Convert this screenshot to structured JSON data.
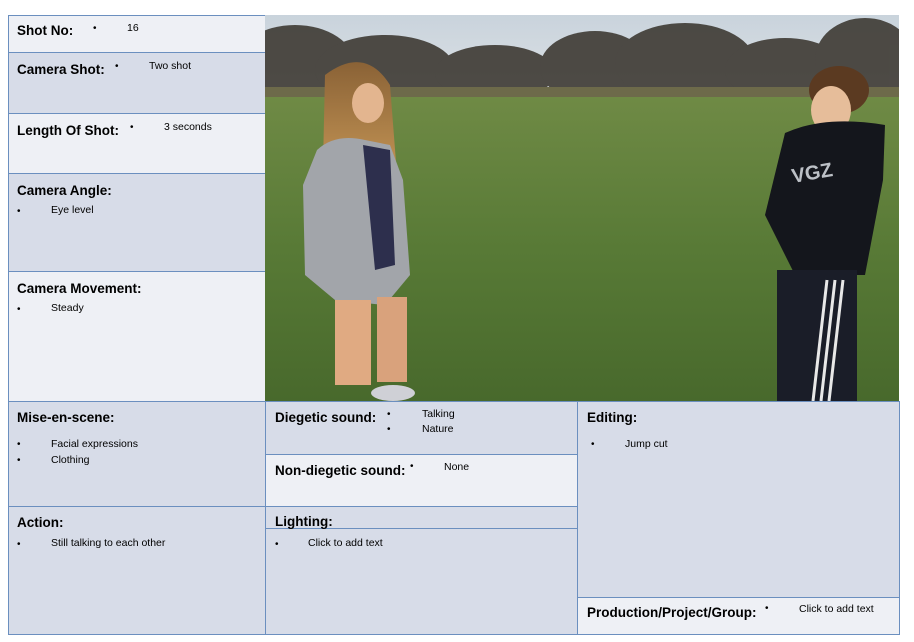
{
  "shot_no": {
    "label": "Shot No:",
    "value": "16"
  },
  "camera_shot": {
    "label": "Camera Shot:",
    "value": "Two shot"
  },
  "length_of_shot": {
    "label": "Length Of Shot:",
    "value": "3 seconds"
  },
  "camera_angle": {
    "label": "Camera Angle:",
    "value": "Eye level"
  },
  "camera_movement": {
    "label": "Camera Movement:",
    "value": "Steady"
  },
  "mise_en_scene": {
    "label": "Mise-en-scene:",
    "items": [
      "Facial expressions",
      "Clothing"
    ]
  },
  "diegetic_sound": {
    "label": "Diegetic sound:",
    "items": [
      "Talking",
      "Nature"
    ]
  },
  "non_diegetic_sound": {
    "label": "Non-diegetic sound:",
    "value": "None"
  },
  "editing": {
    "label": "Editing:",
    "value": "Jump cut"
  },
  "action": {
    "label": "Action:",
    "value": "Still talking to each other"
  },
  "lighting": {
    "label": "Lighting:",
    "value": "Click to add text"
  },
  "production": {
    "label": "Production/Project/Group:",
    "value": "Click to add text"
  },
  "photo": {
    "hoodie_text": "VGZ"
  },
  "bullet": "•",
  "colors": {
    "border": "#6b8fbf",
    "cell_light": "#eef0f5",
    "cell_dark": "#d7dce8"
  }
}
